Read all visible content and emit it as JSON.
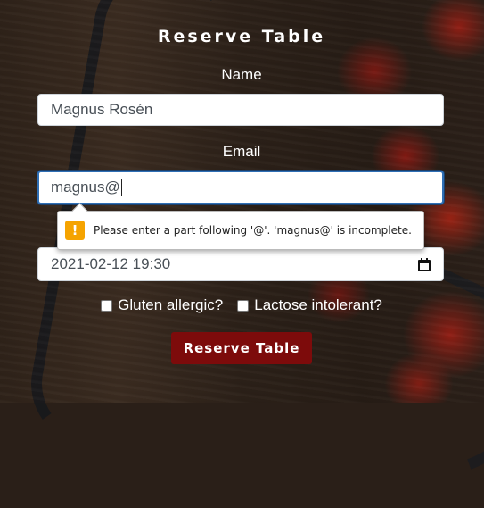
{
  "form": {
    "title": "Reserve Table",
    "name_label": "Name",
    "name_value": "Magnus Rosén",
    "email_label": "Email",
    "email_value": "magnus@",
    "date_value": "2021-02-12 19:30",
    "checkbox_gluten": "Gluten allergic?",
    "checkbox_lactose": "Lactose intolerant?",
    "submit_label": "Reserve Table"
  },
  "validation": {
    "warning_glyph": "!",
    "message": "Please enter a part following '@'. 'magnus@' is incomplete."
  },
  "colors": {
    "submit_background": "#7d0b0b",
    "focus_border": "#2f6fb5",
    "warning_icon": "#f5a300"
  }
}
